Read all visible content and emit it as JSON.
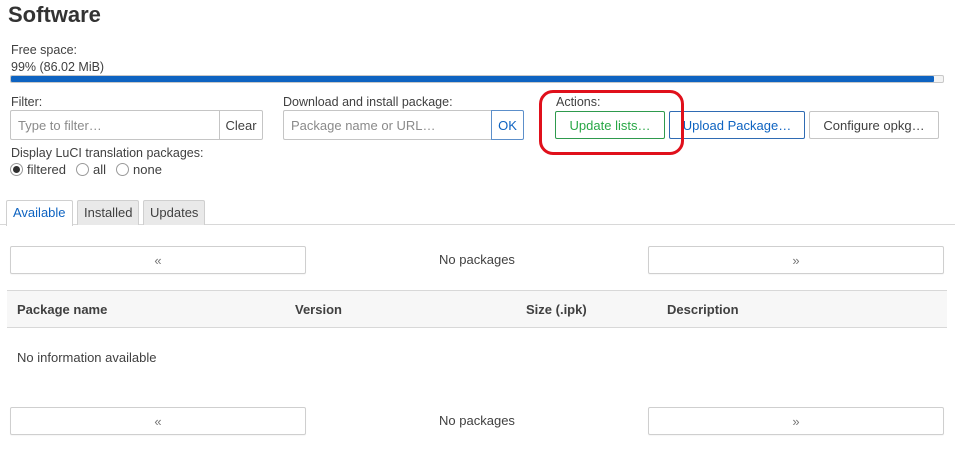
{
  "page": {
    "title": "Software"
  },
  "free_space": {
    "label": "Free space:",
    "value": "99% (86.02 MiB)",
    "percent": 99,
    "bar_color": "#0e63c1"
  },
  "filter": {
    "label": "Filter:",
    "placeholder": "Type to filter…",
    "value": "",
    "clear_label": "Clear"
  },
  "download": {
    "label": "Download and install package:",
    "placeholder": "Package name or URL…",
    "value": "",
    "ok_label": "OK"
  },
  "actions": {
    "label": "Actions:",
    "update_label": "Update lists…",
    "upload_label": "Upload Package…",
    "configure_label": "Configure opkg…",
    "highlight_color": "#e0101b"
  },
  "translation": {
    "label": "Display LuCI translation packages:",
    "options": [
      {
        "label": "filtered",
        "selected": true
      },
      {
        "label": "all",
        "selected": false
      },
      {
        "label": "none",
        "selected": false
      }
    ]
  },
  "tabs": [
    {
      "label": "Available",
      "active": true
    },
    {
      "label": "Installed",
      "active": false
    },
    {
      "label": "Updates",
      "active": false
    }
  ],
  "pager": {
    "prev": "«",
    "next": "»",
    "status": "No packages"
  },
  "table": {
    "columns": [
      "Package name",
      "Version",
      "Size (.ipk)",
      "Description"
    ],
    "empty_text": "No information available"
  },
  "colors": {
    "accent": "#0e63c1",
    "positive": "#28a745"
  }
}
